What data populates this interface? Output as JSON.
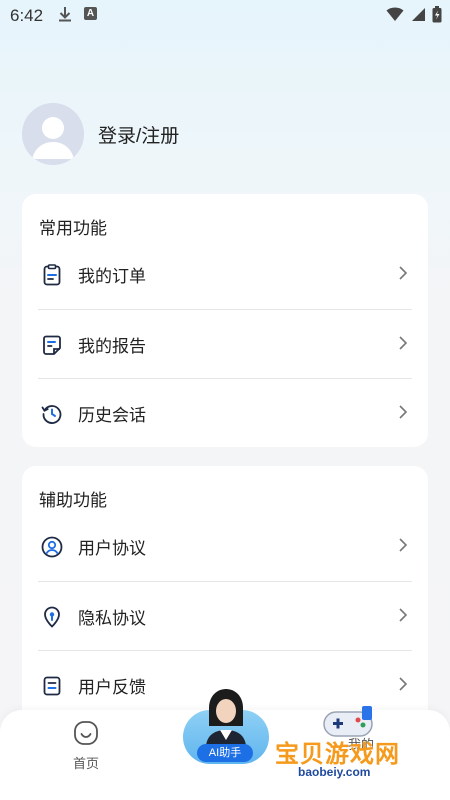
{
  "status_bar": {
    "time": "6:42"
  },
  "profile": {
    "login_label": "登录/注册"
  },
  "common_section": {
    "title": "常用功能",
    "items": [
      {
        "label": "我的订单",
        "icon": "clipboard-icon"
      },
      {
        "label": "我的报告",
        "icon": "report-icon"
      },
      {
        "label": "历史会话",
        "icon": "history-icon"
      }
    ]
  },
  "aux_section": {
    "title": "辅助功能",
    "items": [
      {
        "label": "用户协议",
        "icon": "user-circle-icon"
      },
      {
        "label": "隐私协议",
        "icon": "location-shield-icon"
      },
      {
        "label": "用户反馈",
        "icon": "feedback-icon"
      }
    ]
  },
  "tabbar": {
    "home_label": "首页",
    "ai_label": "AI助手",
    "mine_label": "我的"
  },
  "watermark": {
    "text": "宝贝游戏网",
    "url": "baobeiy.com"
  },
  "colors": {
    "accent": "#1d6fe6",
    "icon_dark": "#1f2a44",
    "watermark": "#f59a1c"
  }
}
